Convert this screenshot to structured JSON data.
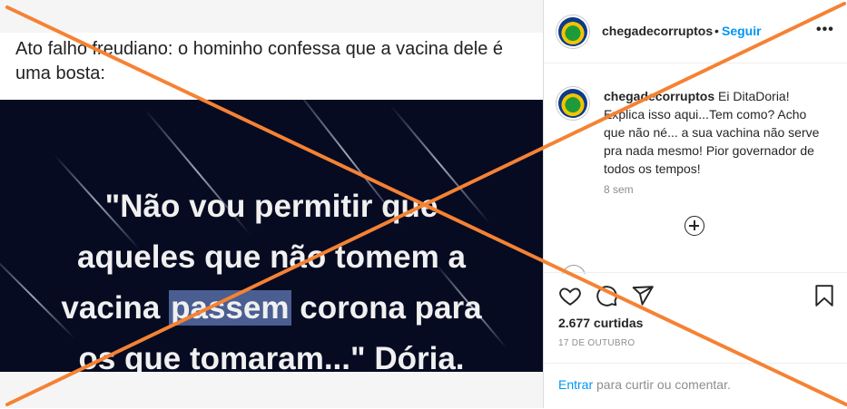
{
  "media": {
    "caption": "Ato falho freudiano: o hominho confessa que a vacina dele é uma bosta:",
    "quote_lines": [
      "\"Não vou permitir que",
      "aqueles que não tomem a"
    ],
    "quote_line3_before": "vacina ",
    "quote_highlight": "passem",
    "quote_line3_after": " corona para",
    "quote_line4": "os que tomaram...\" Dória."
  },
  "post": {
    "username": "chegadecorruptos",
    "dot": "•",
    "follow_label": "Seguir",
    "more_label": "•••",
    "comment": {
      "username": "chegadecorruptos",
      "text": " Ei DitaDoria! Explica isso aqui...Tem como? Acho que não né... a sua vachina não serve pra nada mesmo! Pior governador de todos os tempos!",
      "time": "8 sem"
    },
    "likes": "2.677 curtidas",
    "date": "17 DE OUTUBRO",
    "login_link": "Entrar",
    "login_text": " para curtir ou comentar."
  },
  "icons": [
    "heart-icon",
    "comment-icon",
    "share-icon",
    "bookmark-icon",
    "load-more-icon",
    "avatar",
    "more-options-icon"
  ],
  "colors": {
    "cross": "#f58233",
    "follow": "#0095f6",
    "photo_bg": "#060b22",
    "highlight": "#4a5e92"
  }
}
